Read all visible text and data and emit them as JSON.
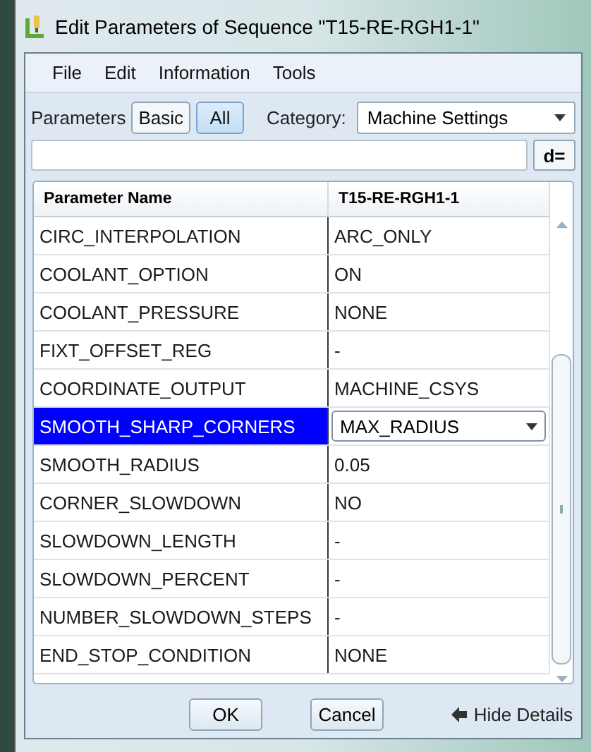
{
  "window": {
    "title": "Edit Parameters of Sequence \"T15-RE-RGH1-1\""
  },
  "menu": [
    "File",
    "Edit",
    "Information",
    "Tools"
  ],
  "filter": {
    "label": "Parameters",
    "modes": [
      {
        "label": "Basic",
        "selected": false
      },
      {
        "label": "All",
        "selected": true
      }
    ],
    "category_label": "Category:",
    "category": "Machine Settings"
  },
  "search": {
    "button": "d="
  },
  "table": {
    "columns": [
      "Parameter Name",
      "T15-RE-RGH1-1"
    ],
    "rows": [
      {
        "name": "CIRC_INTERPOLATION",
        "value": "ARC_ONLY",
        "kind": "text",
        "selected": false
      },
      {
        "name": "COOLANT_OPTION",
        "value": "ON",
        "kind": "text",
        "selected": false
      },
      {
        "name": "COOLANT_PRESSURE",
        "value": "NONE",
        "kind": "text",
        "selected": false
      },
      {
        "name": "FIXT_OFFSET_REG",
        "value": "-",
        "kind": "text",
        "selected": false
      },
      {
        "name": "COORDINATE_OUTPUT",
        "value": "MACHINE_CSYS",
        "kind": "text",
        "selected": false
      },
      {
        "name": "SMOOTH_SHARP_CORNERS",
        "value": "MAX_RADIUS",
        "kind": "dropdown",
        "selected": true
      },
      {
        "name": "SMOOTH_RADIUS",
        "value": "0.05",
        "kind": "text",
        "selected": false
      },
      {
        "name": "CORNER_SLOWDOWN",
        "value": "NO",
        "kind": "text",
        "selected": false
      },
      {
        "name": "SLOWDOWN_LENGTH",
        "value": "-",
        "kind": "text",
        "selected": false
      },
      {
        "name": "SLOWDOWN_PERCENT",
        "value": "-",
        "kind": "text",
        "selected": false
      },
      {
        "name": "NUMBER_SLOWDOWN_STEPS",
        "value": "-",
        "kind": "text",
        "selected": false
      },
      {
        "name": "END_STOP_CONDITION",
        "value": "NONE",
        "kind": "text",
        "selected": false
      }
    ]
  },
  "buttons": [
    "OK",
    "Cancel"
  ],
  "details_link": "Hide Details"
}
